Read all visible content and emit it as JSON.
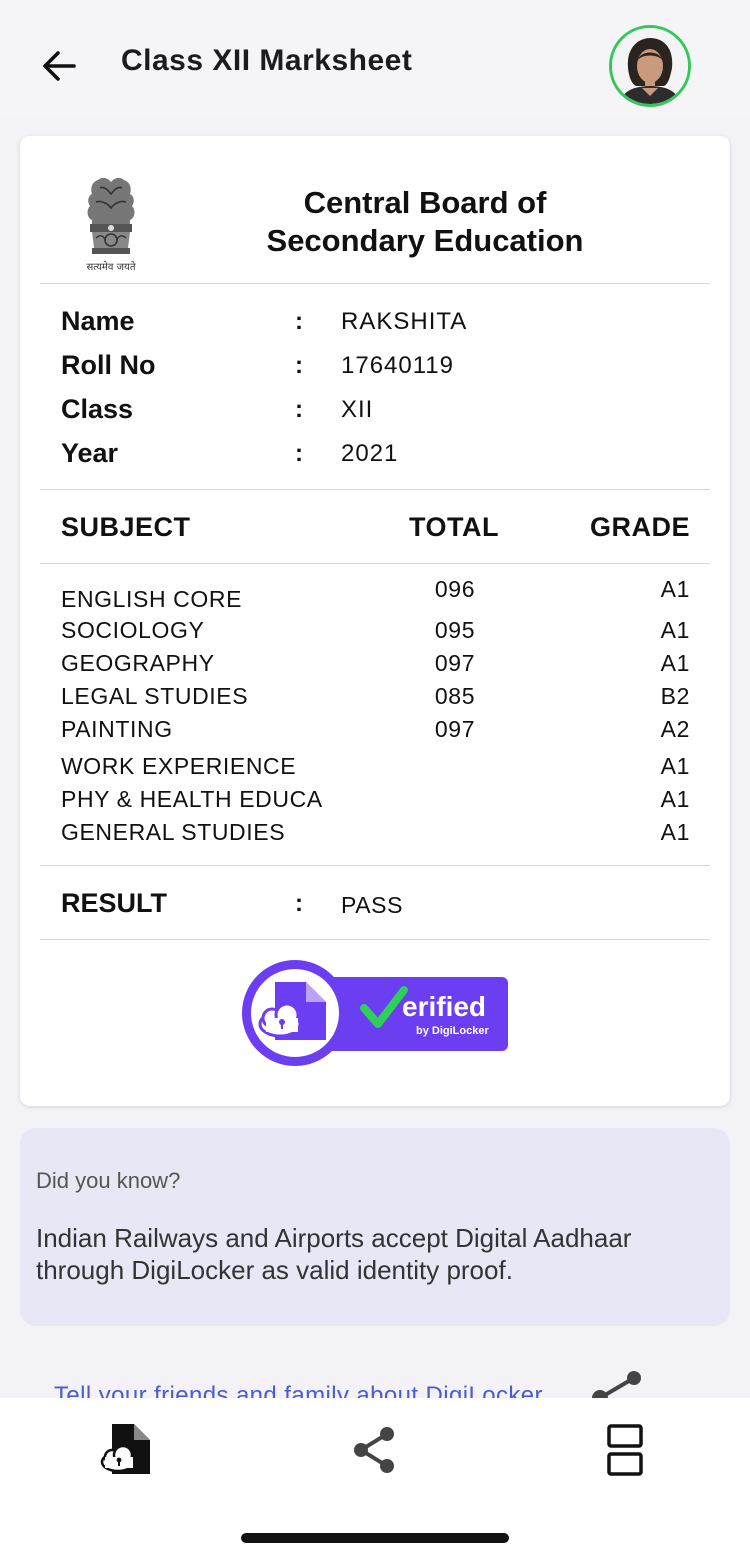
{
  "header": {
    "title": "Class XII Marksheet"
  },
  "document": {
    "board_line1": "Central Board of",
    "board_line2": "Secondary Education",
    "emblem_motto": "सत्यमेव जयते",
    "info": [
      {
        "label": "Name",
        "colon": ":",
        "value": "RAKSHITA"
      },
      {
        "label": "Roll No",
        "colon": ":",
        "value": "17640119"
      },
      {
        "label": "Class",
        "colon": ":",
        "value": "XII"
      },
      {
        "label": "Year",
        "colon": ":",
        "value": "2021"
      }
    ],
    "columns": {
      "subject": "SUBJECT",
      "total": "TOTAL",
      "grade": "GRADE"
    },
    "subjects": [
      {
        "name": "ENGLISH CORE",
        "total": "096",
        "grade": "A1"
      },
      {
        "name": "SOCIOLOGY",
        "total": "095",
        "grade": "A1"
      },
      {
        "name": "GEOGRAPHY",
        "total": "097",
        "grade": "A1"
      },
      {
        "name": "LEGAL STUDIES",
        "total": "085",
        "grade": "B2"
      },
      {
        "name": "PAINTING",
        "total": "097",
        "grade": "A2"
      },
      {
        "name": "WORK EXPERIENCE",
        "total": "",
        "grade": "A1"
      },
      {
        "name": "PHY & HEALTH EDUCA",
        "total": "",
        "grade": "A1"
      },
      {
        "name": "GENERAL STUDIES",
        "total": "",
        "grade": "A1"
      }
    ],
    "result": {
      "label": "RESULT",
      "colon": ":",
      "value": "PASS"
    },
    "badge": {
      "verified_text": "erified",
      "by_text": "by DigiLocker"
    }
  },
  "tip": {
    "heading": "Did you know?",
    "body": "Indian Railways and Airports accept Digital Aadhaar through DigiLocker as valid identity proof."
  },
  "share_link": {
    "text": "Tell your friends and family about DigiLocker"
  },
  "colors": {
    "accent_purple": "#6c3ef1",
    "check_green": "#2ed158",
    "avatar_ring": "#34c759",
    "link_blue": "#4a5bd4",
    "tip_bg": "#e7e7f5"
  },
  "icons": {
    "back": "arrow-left-icon",
    "nav": [
      "cloud-document-icon",
      "share-icon",
      "split-view-icon"
    ]
  }
}
